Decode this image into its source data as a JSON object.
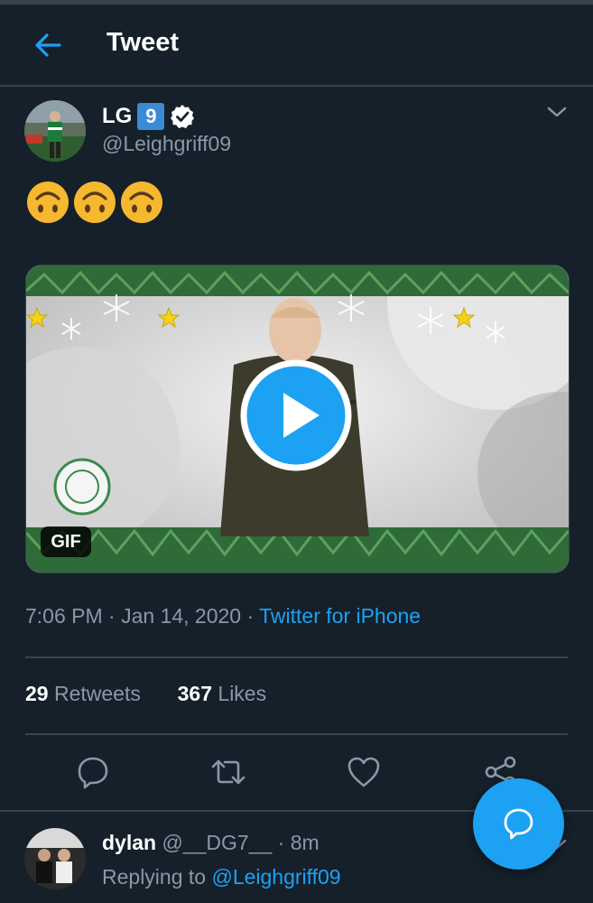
{
  "header": {
    "title": "Tweet"
  },
  "tweet": {
    "author_name": "LG",
    "author_badge": "9",
    "handle": "@Leighgriff09",
    "emoji_count": 3,
    "timestamp": "7:06 PM · Jan 14, 2020 · ",
    "source": "Twitter for iPhone",
    "media_badge": "GIF",
    "retweets_count": "29",
    "retweets_label": "Retweets",
    "likes_count": "367",
    "likes_label": "Likes"
  },
  "reply": {
    "name": "dylan",
    "handle_time": "@__DG7__ · 8m",
    "replying_prefix": "Replying to ",
    "replying_to": "@Leighgriff09"
  },
  "colors": {
    "background": "#15202b",
    "accent": "#1da1f2",
    "muted": "#8899a6",
    "divider": "#38444d"
  },
  "icons": [
    "back-arrow-icon",
    "verified-icon",
    "chevron-down-icon",
    "play-icon",
    "reply-icon",
    "retweet-icon",
    "like-icon",
    "share-icon",
    "compose-reply-icon"
  ]
}
